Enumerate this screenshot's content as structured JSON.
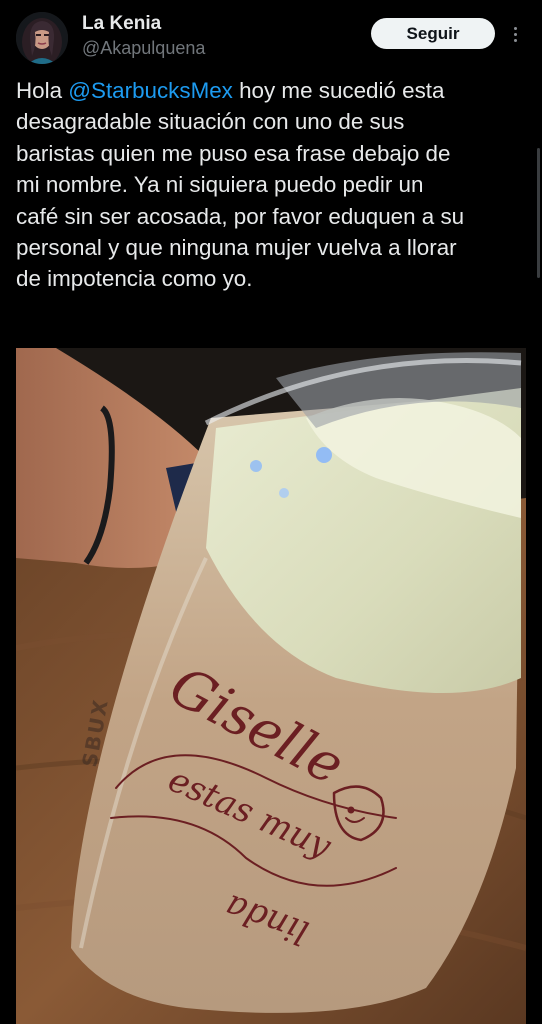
{
  "user": {
    "display_name": "La Kenia",
    "handle": "@Akapulquena",
    "avatar_icon": "profile-avatar-icon"
  },
  "actions": {
    "follow_label": "Seguir",
    "more_icon": "more-options-icon"
  },
  "tweet": {
    "text_before_mention": "Hola ",
    "mention": "@StarbucksMex",
    "lines": [
      " hoy me sucedió esta",
      "desagradable situación con uno de sus",
      "baristas quien me puso esa frase debajo de",
      "mi nombre. Ya ni siquiera puedo pedir un",
      "café sin ser acosada, por favor eduquen a su",
      "personal y que ninguna mujer vuelva a llorar",
      "de impotencia como yo."
    ]
  },
  "media": {
    "cup_name": "Giselle",
    "cup_message_line1": "estas muy",
    "cup_message_line2": "linda"
  },
  "colors": {
    "background": "#000000",
    "text": "#e7e9ea",
    "secondary_text": "#71767b",
    "link": "#1d9bf0",
    "button_bg": "#eff3f4",
    "button_text": "#0f1419",
    "marker_ink": "#6b1f22"
  }
}
